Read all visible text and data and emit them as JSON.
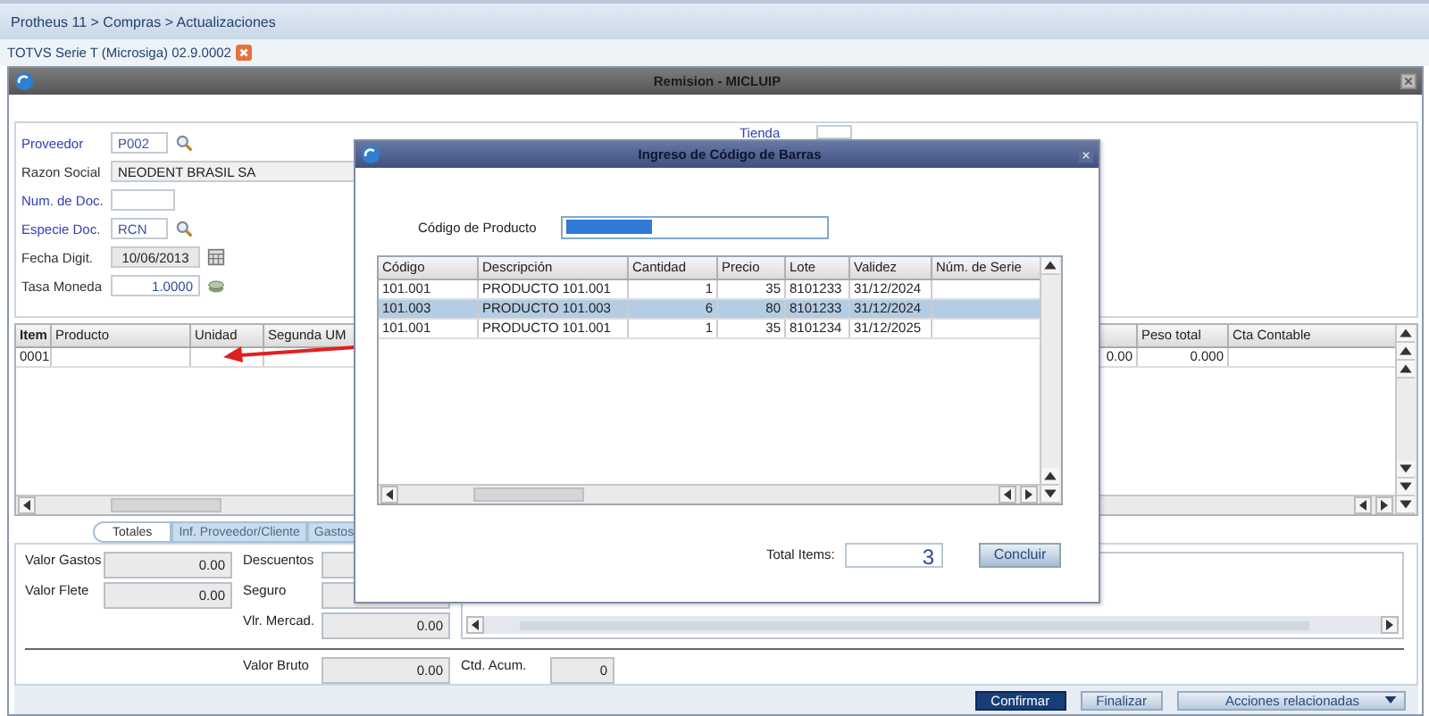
{
  "breadcrumb": "Protheus 11 > Compras  > Actualizaciones",
  "session_tab": {
    "label": "TOTVS Serie T  (Microsiga) 02.9.0002"
  },
  "window": {
    "title": "Remision - MICLUIP"
  },
  "form": {
    "fields": [
      {
        "label": "Proveedor",
        "value": "P002",
        "required": true,
        "kind": "lookup"
      },
      {
        "label": "Razon Social",
        "value": "NEODENT BRASIL SA",
        "required": false,
        "kind": "wide"
      },
      {
        "label": "Num. de Doc.",
        "required": true,
        "kind": "text"
      },
      {
        "label": "Especie Doc.",
        "value": "RCN",
        "required": true,
        "kind": "lookup"
      },
      {
        "label": "Fecha Digit.",
        "value": "10/06/2013",
        "required": false,
        "kind": "date"
      },
      {
        "label": "Tasa Moneda",
        "value": "1.0000",
        "required": false,
        "kind": "currency"
      }
    ],
    "side_field": {
      "label": "Tienda"
    }
  },
  "items_grid": {
    "columns": [
      {
        "label": "Item",
        "kind": "text"
      },
      {
        "label": "Producto",
        "kind": "text"
      },
      {
        "label": "Unidad",
        "kind": "text"
      },
      {
        "label": "Segunda UM",
        "kind": "text"
      },
      {
        "kind": "number"
      },
      {
        "label": "Peso total",
        "kind": "number"
      },
      {
        "label": "Cta Contable",
        "kind": "text"
      }
    ],
    "rows": [
      [
        "0001",
        "",
        "",
        "",
        "0.00",
        "0.000",
        ""
      ]
    ]
  },
  "bottom_tabs": [
    {
      "label": "Totales",
      "selected": true
    },
    {
      "label": "Inf. Proveedor/Cliente",
      "selected": false
    },
    {
      "label": "Gastos",
      "selected": false
    }
  ],
  "totals": {
    "left": [
      {
        "label": "Valor Gastos",
        "value": "0.00"
      },
      {
        "label": "Valor Flete",
        "value": "0.00"
      }
    ],
    "middle": [
      {
        "label": "Descuentos"
      },
      {
        "label": "Seguro"
      },
      {
        "label": "Vlr. Mercad.",
        "value": "0.00"
      }
    ],
    "valor_bruto": {
      "label": "Valor Bruto",
      "value": "0.00"
    },
    "ctd_acum": {
      "label": "Ctd. Acum.",
      "value": "0"
    }
  },
  "buttons": [
    {
      "label": "Confirmar",
      "kind": "primary"
    },
    {
      "label": "Finalizar",
      "kind": "plain"
    },
    {
      "label": "Acciones relacionadas",
      "kind": "dropdown"
    }
  ],
  "dialog": {
    "title": "Ingreso de Código de Barras",
    "product_code": {
      "label": "Código de Producto",
      "text_selected": true
    },
    "grid": {
      "columns": [
        {
          "label": "Código",
          "kind": "text"
        },
        {
          "label": "Descripción",
          "kind": "text"
        },
        {
          "label": "Cantidad",
          "kind": "number"
        },
        {
          "label": "Precio",
          "kind": "number"
        },
        {
          "label": "Lote",
          "kind": "text"
        },
        {
          "label": "Validez",
          "kind": "text"
        },
        {
          "label": "Núm. de Serie",
          "kind": "text"
        }
      ],
      "rows": [
        {
          "cells": [
            "101.001",
            "PRODUCTO 101.001",
            "1",
            "35",
            "8101233",
            "31/12/2024",
            ""
          ],
          "selected": false
        },
        {
          "cells": [
            "101.003",
            "PRODUCTO 101.003",
            "6",
            "80",
            "8101233",
            "31/12/2024",
            ""
          ],
          "selected": true
        },
        {
          "cells": [
            "101.001",
            "PRODUCTO 101.001",
            "1",
            "35",
            "8101234",
            "31/12/2025",
            ""
          ],
          "selected": false
        }
      ]
    },
    "total_items": {
      "label": "Total Items:",
      "value": "3"
    },
    "button": "Concluir"
  }
}
